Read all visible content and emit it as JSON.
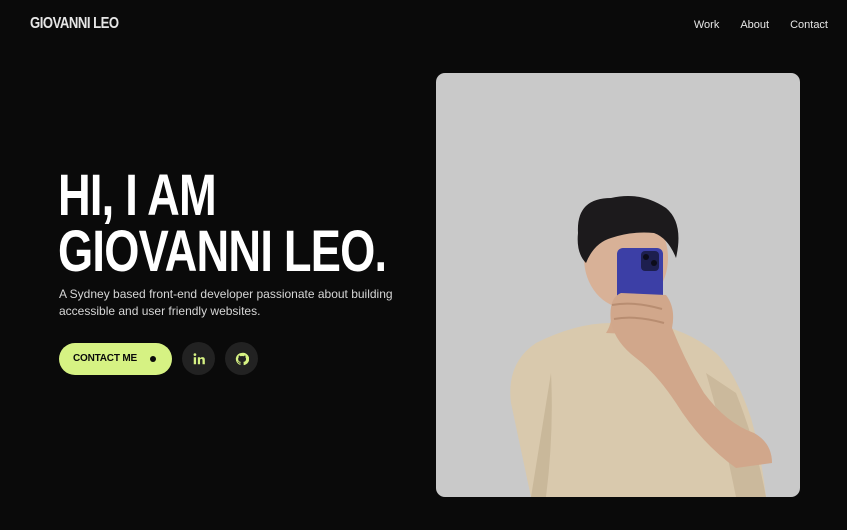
{
  "header": {
    "logo": "GIOVANNI LEO",
    "nav": [
      "Work",
      "About",
      "Contact"
    ]
  },
  "hero": {
    "title_line1": "HI, I AM",
    "title_line2": "GIOVANNI LEO.",
    "tagline": "A Sydney based front-end developer passionate about building accessible and user friendly websites.",
    "contact_label": "CONTACT ME"
  },
  "social": [
    {
      "icon": "linkedin-icon"
    },
    {
      "icon": "github-icon"
    }
  ],
  "colors": {
    "background": "#0a0a0a",
    "accent": "#d6f283",
    "social_bg": "#222222",
    "photo_bg": "#c9c9c9"
  }
}
